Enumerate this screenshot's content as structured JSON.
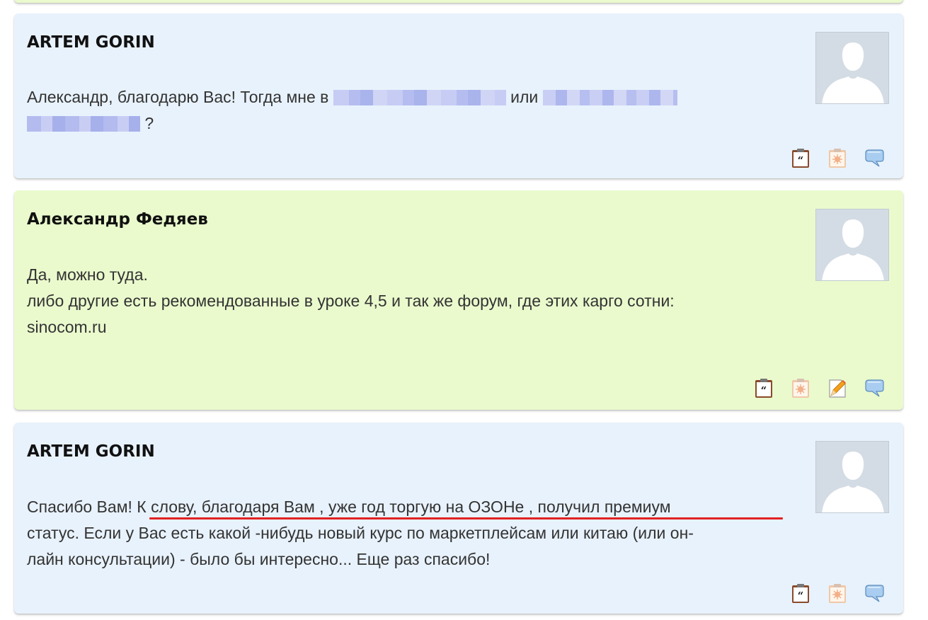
{
  "posts": [
    {
      "author": "ARTEM GORIN",
      "lines": [
        "Александр, благодарю Вас! Тогда мне в",
        "или",
        "?"
      ]
    },
    {
      "author": "Александр Федяев",
      "lines": [
        "Да, можно туда.",
        "либо другие есть рекомендованные в уроке 4,5 и так же форум, где этих карго сотни:",
        "sinocom.ru"
      ]
    },
    {
      "author": "ARTEM GORIN",
      "lines": [
        "Спасибо Вам! К слову, благодаря Вам , уже год торгую на ОЗОНе , получил премиум",
        "статус. Если у Вас есть какой -нибудь новый курс по маркетплейсам или китаю (или он-",
        "лайн консультации) - было бы интересно... Еще раз спасибо!"
      ]
    }
  ],
  "icons": {
    "quote": "quote-icon",
    "report": "report-icon",
    "edit": "edit-icon",
    "reply": "reply-icon"
  },
  "colors": {
    "post_blue": "#e8f2fc",
    "post_green": "#eafacd",
    "underline": "#e22222",
    "blur": "#aab4ea"
  }
}
